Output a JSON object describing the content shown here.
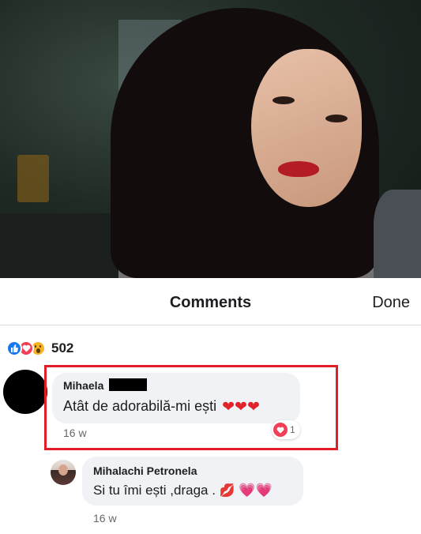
{
  "header": {
    "title": "Comments",
    "done_label": "Done"
  },
  "reactions": {
    "count": "502",
    "types": [
      "like-icon",
      "love-icon",
      "wow-icon"
    ]
  },
  "comments": [
    {
      "author": "Mihaela",
      "text": "Atât de adorabilă-mi ești",
      "emojis": "❤❤❤",
      "time": "16 w",
      "reaction_count": "1"
    },
    {
      "author": "Mihalachi Petronela",
      "text": "Si tu îmi ești ,draga .",
      "emojis": [
        "💋",
        "💗",
        "💗"
      ],
      "time": "16 w"
    }
  ],
  "colors": {
    "highlight": "#e31e24",
    "like": "#1877f2",
    "love": "#f33e58",
    "wow": "#f7b125"
  }
}
